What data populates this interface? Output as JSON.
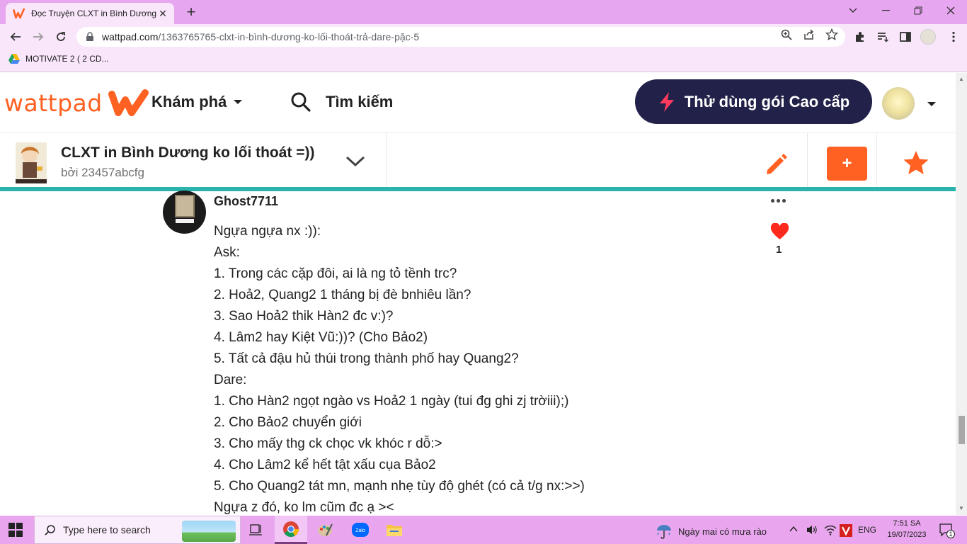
{
  "browser": {
    "tab_title": "Đọc Truyện CLXT in Bình Dương ko lối thoát",
    "tab_close": "✕",
    "new_tab": "+",
    "url_host": "wattpad.com",
    "url_path": "/1363765765-clxt-in-bình-dương-ko-lối-thoát-trả-dare-pặc-5",
    "bookmark": "MOTIVATE 2 ( 2 CD..."
  },
  "header": {
    "logo_text": "wattpad",
    "explore_label": "Khám phá",
    "search_label": "Tìm kiếm",
    "premium_label": "Thử dùng gói Cao cấp"
  },
  "story": {
    "title": "CLXT in Bình Dương ko lối thoát =))",
    "author": "bởi 23457abcfg",
    "add_label": "+"
  },
  "comment": {
    "username": "Ghost7711",
    "like_count": "1",
    "lines": [
      "Ngựa ngựa nx :)):",
      "Ask:",
      "1. Trong các cặp đôi, ai là ng tỏ tềnh trc?",
      "2. Hoả2, Quang2 1 tháng bị đè bnhiêu lần?",
      "3. Sao Hoả2 thik Hàn2 đc v:)?",
      "4. Lâm2 hay Kiệt Vũ:))? (Cho Bảo2)",
      "5. Tất cả đậu hủ thúi trong thành phố hay Quang2?",
      "Dare:",
      "1. Cho Hàn2 ngọt ngào vs Hoả2 1 ngày (tui đg ghi zj trờiii);)",
      "2. Cho Bảo2 chuyển giới",
      "3. Cho mấy thg ck chọc vk khóc r dỗ:>",
      "4. Cho Lâm2 kể hết tật xấu cụa Bảo2",
      "5. Cho Quang2 tát mn, mạnh nhẹ tùy độ ghét (có cả t/g nx:>>)",
      "Ngựa z đó, ko lm cũm đc ạ ><"
    ]
  },
  "taskbar": {
    "search_placeholder": "Type here to search",
    "weather": "Ngày mai có mưa rào",
    "lang": "ENG",
    "time": "7:51 SA",
    "date": "19/07/2023",
    "notif_count": "1"
  },
  "colors": {
    "brand_orange": "#ff6122",
    "premium_navy": "#222149",
    "teal": "#2bb3ae",
    "chrome_pink": "#e7a6f0"
  }
}
